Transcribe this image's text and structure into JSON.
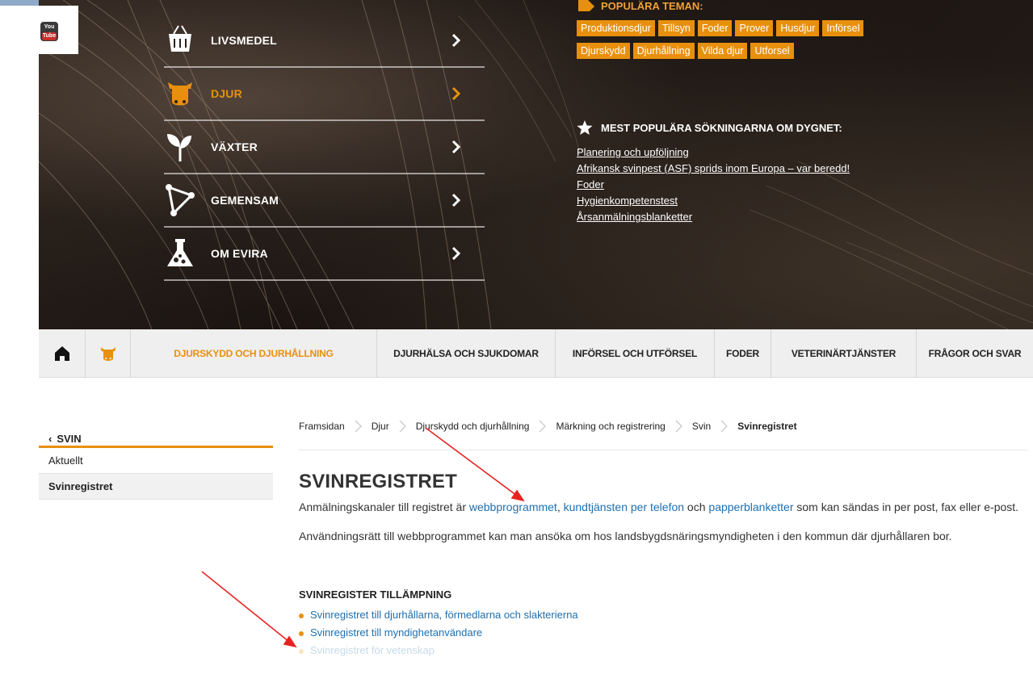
{
  "youtube": {
    "line1": "You",
    "line2": "Tube"
  },
  "main_nav": [
    {
      "label": "LIVSMEDEL",
      "icon": "basket-icon",
      "active": false
    },
    {
      "label": "DJUR",
      "icon": "cow-icon",
      "active": true
    },
    {
      "label": "VÄXTER",
      "icon": "sprout-icon",
      "active": false
    },
    {
      "label": "GEMENSAM",
      "icon": "network-icon",
      "active": false
    },
    {
      "label": "OM EVIRA",
      "icon": "flask-icon",
      "active": false
    }
  ],
  "popular_topics": {
    "heading": "POPULÄRA TEMAN:",
    "tags": [
      "Produktionsdjur",
      "Tillsyn",
      "Foder",
      "Prover",
      "Husdjur",
      "Införsel",
      "Djurskydd",
      "Djurhållning",
      "Vilda djur",
      "Utforsel"
    ]
  },
  "popular_searches": {
    "heading": "MEST POPULÄRA SÖKNINGARNA OM DYGNET:",
    "links": [
      "Planering och upföljning",
      "Afrikansk svinpest (ASF) sprids inom Europa – var beredd!",
      "Foder",
      "Hygienkompetenstest",
      "Årsanmälningsblanketter"
    ]
  },
  "sub_nav": {
    "items": [
      "DJURSKYDD OCH DJURHÅLLNING",
      "DJURHÄLSA OCH SJUKDOMAR",
      "INFÖRSEL OCH UTFÖRSEL",
      "FODER",
      "VETERINÄRTJÄNSTER",
      "FRÅGOR OCH SVAR"
    ]
  },
  "sidebar": {
    "back_label": "SVIN",
    "items": [
      "Aktuellt",
      "Svinregistret"
    ]
  },
  "breadcrumb": [
    "Framsidan",
    "Djur",
    "Djurskydd och djurhållning",
    "Märkning och registrering",
    "Svin",
    "Svinregistret"
  ],
  "content": {
    "title": "SVINREGISTRET",
    "p1_start": "Anmälningskanaler till registret är ",
    "p1_link1": "webbprogrammet",
    "p1_comma": ", ",
    "p1_link2": "kundtjänsten per telefon",
    "p1_och": " och ",
    "p1_link3": "papperblanketter",
    "p1_end": " som kan sändas in per post, fax eller e-post.",
    "p2": "Användningsrätt till webbprogrammet kan man ansöka om hos landsbygdsnäringsmyndigheten i den kommun där djurhållaren bor.",
    "section_heading": "SVINREGISTER TILLÄMPNING",
    "links": [
      "Svinregistret till djurhållarna, förmedlarna och slakterierna",
      "Svinregistret till myndighetanvändare",
      "Svinregistret för vetenskap"
    ]
  },
  "colors": {
    "accent": "#e8900e",
    "link": "#1d6fb0",
    "annotation": "#e8231f"
  }
}
